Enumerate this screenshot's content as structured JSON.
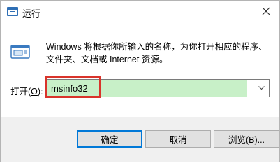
{
  "window": {
    "title": "运行"
  },
  "icons": {
    "app": "run-icon",
    "close": "close-icon",
    "dropdown": "chevron-down-icon"
  },
  "description": {
    "line1": "Windows 将根据你所输入的名称，为你打开相应的程序、",
    "line2": "文件夹、文档或 Internet 资源。"
  },
  "open": {
    "label_prefix": "打开(",
    "label_key": "O",
    "label_suffix": "):",
    "value": "msinfo32"
  },
  "buttons": {
    "ok": "确定",
    "cancel": "取消",
    "browse": "浏览(B)..."
  },
  "colors": {
    "input_highlight": "#c8f0c8",
    "annotation_box": "#d9342b",
    "accent": "#0078d7"
  }
}
